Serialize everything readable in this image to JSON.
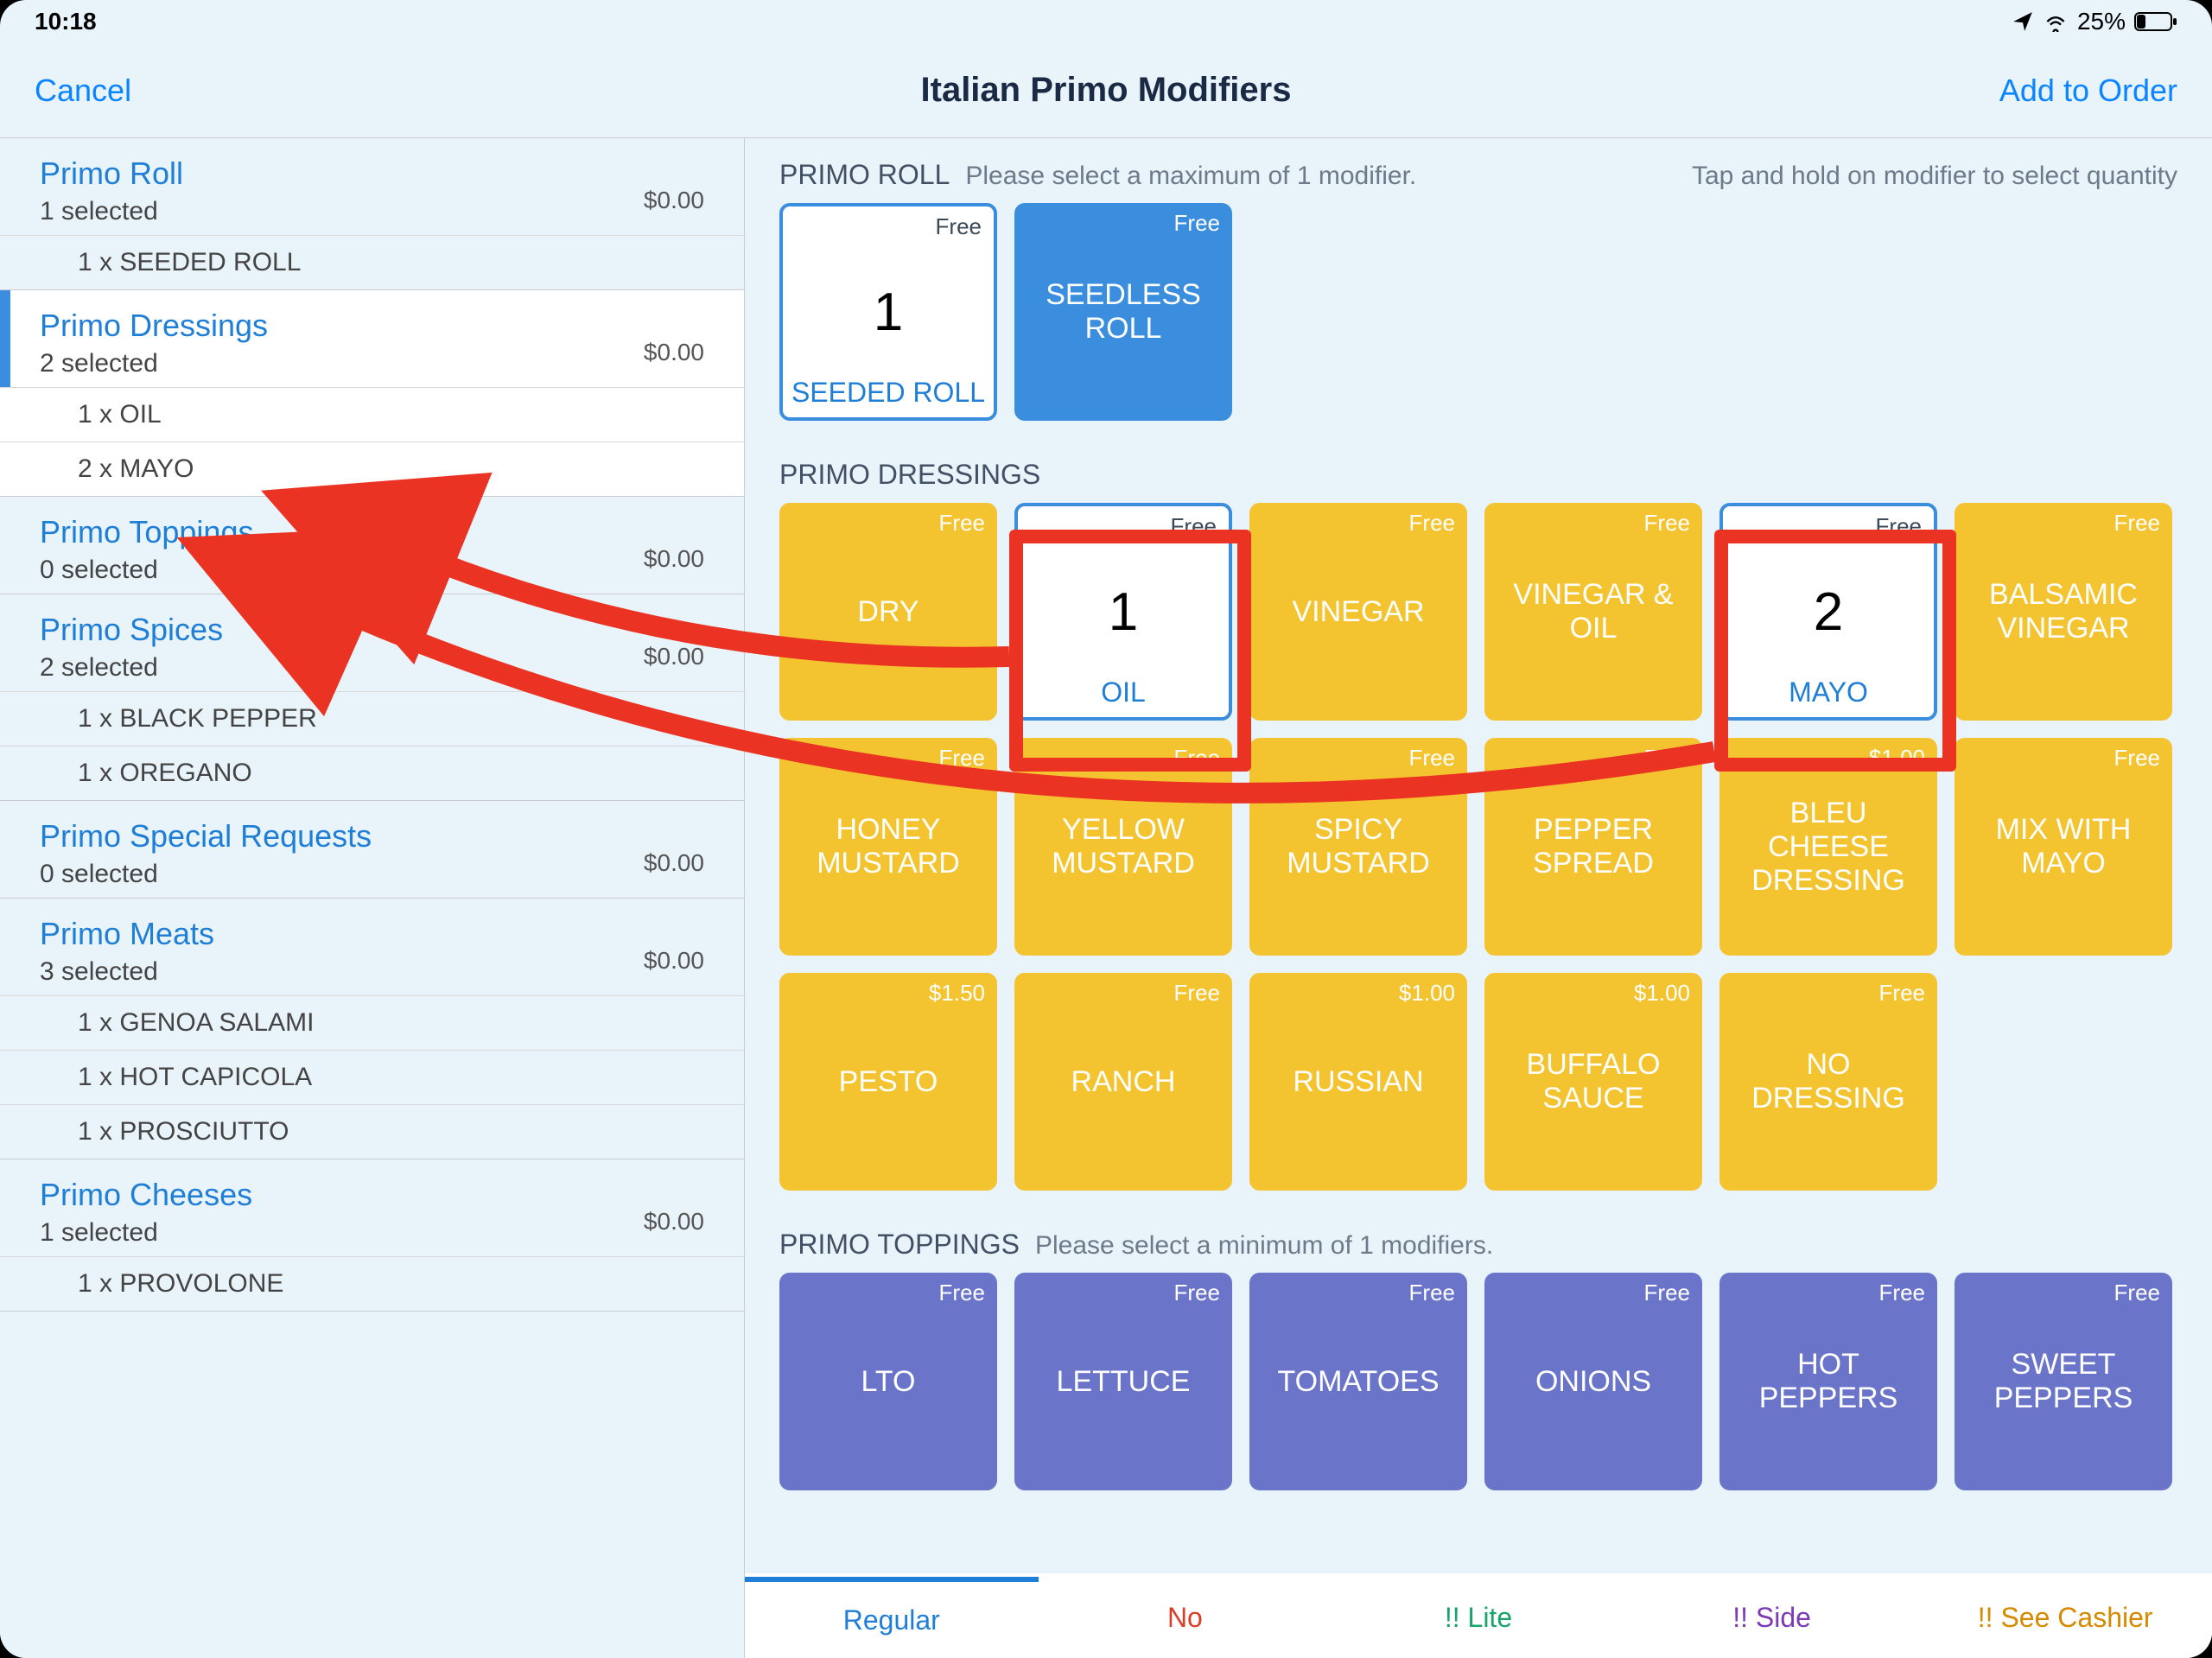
{
  "statusbar": {
    "time": "10:18",
    "battery_text": "25%"
  },
  "nav": {
    "cancel": "Cancel",
    "title": "Italian Primo Modifiers",
    "add": "Add to Order"
  },
  "sidebar": {
    "groups": [
      {
        "title": "Primo Roll",
        "sub": "1 selected",
        "price": "$0.00",
        "active": false,
        "items": [
          "1 x  SEEDED ROLL"
        ]
      },
      {
        "title": "Primo Dressings",
        "sub": "2 selected",
        "price": "$0.00",
        "active": true,
        "items": [
          "1 x  OIL",
          "2 x  MAYO"
        ]
      },
      {
        "title": "Primo Toppings",
        "sub": "0 selected",
        "price": "$0.00",
        "active": false,
        "items": []
      },
      {
        "title": "Primo Spices",
        "sub": "2 selected",
        "price": "$0.00",
        "active": false,
        "items": [
          "1 x  BLACK PEPPER",
          "1 x  OREGANO"
        ]
      },
      {
        "title": "Primo Special Requests",
        "sub": "0 selected",
        "price": "$0.00",
        "active": false,
        "items": []
      },
      {
        "title": "Primo Meats",
        "sub": "3 selected",
        "price": "$0.00",
        "active": false,
        "items": [
          "1 x  GENOA SALAMI",
          "1 x  HOT CAPICOLA",
          "1 x  PROSCIUTTO"
        ]
      },
      {
        "title": "Primo Cheeses",
        "sub": "1 selected",
        "price": "$0.00",
        "active": false,
        "items": [
          "1 x  PROVOLONE"
        ]
      }
    ]
  },
  "sections": {
    "roll": {
      "title": "PRIMO ROLL",
      "sub": "Please select a maximum of 1 modifier.",
      "right": "Tap and hold on modifier to select quantity",
      "tiles": [
        {
          "label": "SEEDED ROLL",
          "price": "Free",
          "selected": true,
          "qty": "1"
        },
        {
          "label": "SEEDLESS ROLL",
          "price": "Free",
          "selected": false,
          "color": "blue"
        }
      ]
    },
    "dressings": {
      "title": "PRIMO DRESSINGS",
      "tiles": [
        {
          "label": "DRY",
          "price": "Free",
          "color": "yellow"
        },
        {
          "label": "OIL",
          "price": "Free",
          "selected": true,
          "qty": "1"
        },
        {
          "label": "VINEGAR",
          "price": "Free",
          "color": "yellow"
        },
        {
          "label": "VINEGAR & OIL",
          "price": "Free",
          "color": "yellow"
        },
        {
          "label": "MAYO",
          "price": "Free",
          "selected": true,
          "qty": "2"
        },
        {
          "label": "BALSAMIC VINEGAR",
          "price": "Free",
          "color": "yellow"
        },
        {
          "label": "HONEY MUSTARD",
          "price": "Free",
          "color": "yellow"
        },
        {
          "label": "YELLOW MUSTARD",
          "price": "Free",
          "color": "yellow"
        },
        {
          "label": "SPICY MUSTARD",
          "price": "Free",
          "color": "yellow"
        },
        {
          "label": "PEPPER SPREAD",
          "price": "Free",
          "color": "yellow"
        },
        {
          "label": "BLEU CHEESE DRESSING",
          "price": "$1.00",
          "color": "yellow"
        },
        {
          "label": "MIX WITH MAYO",
          "price": "Free",
          "color": "yellow"
        },
        {
          "label": "PESTO",
          "price": "$1.50",
          "color": "yellow"
        },
        {
          "label": "RANCH",
          "price": "Free",
          "color": "yellow"
        },
        {
          "label": "RUSSIAN",
          "price": "$1.00",
          "color": "yellow"
        },
        {
          "label": "BUFFALO SAUCE",
          "price": "$1.00",
          "color": "yellow"
        },
        {
          "label": "NO DRESSING",
          "price": "Free",
          "color": "yellow"
        }
      ]
    },
    "toppings": {
      "title": "PRIMO TOPPINGS",
      "sub": "Please select a minimum of 1 modifiers.",
      "tiles": [
        {
          "label": "LTO",
          "price": "Free",
          "color": "purple"
        },
        {
          "label": "LETTUCE",
          "price": "Free",
          "color": "purple"
        },
        {
          "label": "TOMATOES",
          "price": "Free",
          "color": "purple"
        },
        {
          "label": "ONIONS",
          "price": "Free",
          "color": "purple"
        },
        {
          "label": "HOT PEPPERS",
          "price": "Free",
          "color": "purple"
        },
        {
          "label": "SWEET PEPPERS",
          "price": "Free",
          "color": "purple"
        }
      ]
    }
  },
  "tabs": {
    "regular": "Regular",
    "no": "No",
    "lite": "!! Lite",
    "side": "!! Side",
    "cashier": "!! See Cashier"
  }
}
